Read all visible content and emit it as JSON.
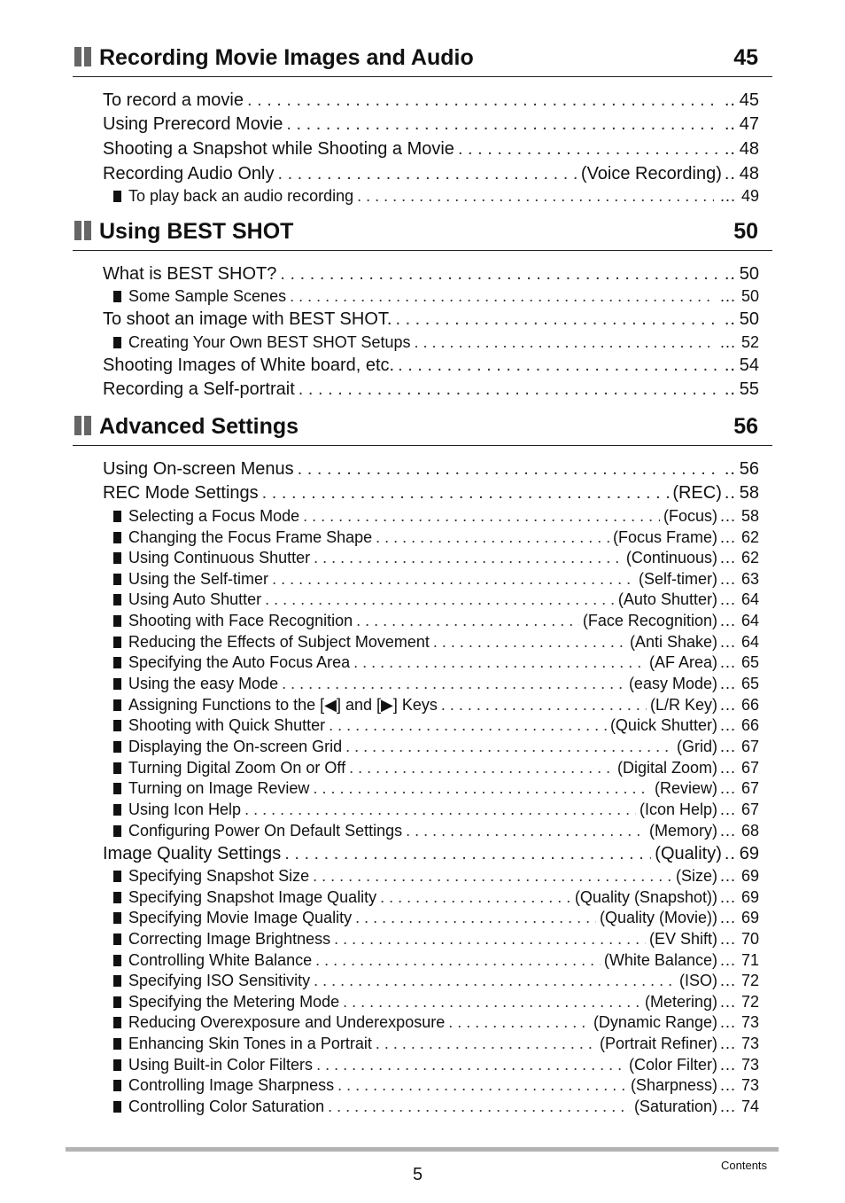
{
  "sections": [
    {
      "title": "Recording Movie Images and Audio",
      "page": "45",
      "entries": [
        {
          "level": 1,
          "label": "To record a movie",
          "ref": "",
          "page": "45"
        },
        {
          "level": 1,
          "label": "Using Prerecord Movie",
          "ref": "",
          "page": "47"
        },
        {
          "level": 1,
          "label": "Shooting a Snapshot while Shooting a Movie",
          "ref": "",
          "page": "48"
        },
        {
          "level": 1,
          "label": "Recording Audio Only",
          "ref": "(Voice Recording)",
          "page": "48"
        },
        {
          "level": 2,
          "label": "To play back an audio recording",
          "ref": "",
          "page": "49"
        }
      ]
    },
    {
      "title": "Using BEST SHOT",
      "page": "50",
      "entries": [
        {
          "level": 1,
          "label": "What is BEST SHOT?",
          "ref": "",
          "page": "50"
        },
        {
          "level": 2,
          "label": "Some Sample Scenes",
          "ref": "",
          "page": "50"
        },
        {
          "level": 1,
          "label": "To shoot an image with BEST SHOT.",
          "ref": "",
          "page": "50"
        },
        {
          "level": 2,
          "label": "Creating Your Own BEST SHOT Setups",
          "ref": "",
          "page": "52"
        },
        {
          "level": 1,
          "label": "Shooting Images of White board, etc.",
          "ref": "",
          "page": "54"
        },
        {
          "level": 1,
          "label": "Recording a Self-portrait",
          "ref": "",
          "page": "55"
        }
      ]
    },
    {
      "title": "Advanced Settings",
      "page": "56",
      "entries": [
        {
          "level": 1,
          "label": "Using On-screen Menus",
          "ref": "",
          "page": "56"
        },
        {
          "level": 1,
          "label": "REC Mode Settings",
          "ref": "(REC)",
          "page": "58"
        },
        {
          "level": 2,
          "label": "Selecting a Focus Mode",
          "ref": "(Focus)",
          "page": "58"
        },
        {
          "level": 2,
          "label": "Changing the Focus Frame Shape",
          "ref": "(Focus Frame)",
          "page": "62"
        },
        {
          "level": 2,
          "label": "Using Continuous Shutter",
          "ref": "(Continuous)",
          "page": "62"
        },
        {
          "level": 2,
          "label": "Using the Self-timer",
          "ref": "(Self-timer)",
          "page": "63"
        },
        {
          "level": 2,
          "label": "Using Auto Shutter",
          "ref": "(Auto Shutter)",
          "page": "64"
        },
        {
          "level": 2,
          "label": "Shooting with Face Recognition",
          "ref": "(Face Recognition)",
          "page": "64"
        },
        {
          "level": 2,
          "label": "Reducing the Effects of Subject Movement",
          "ref": "(Anti Shake)",
          "page": "64"
        },
        {
          "level": 2,
          "label": "Specifying the Auto Focus Area",
          "ref": "(AF Area)",
          "page": "65"
        },
        {
          "level": 2,
          "label": "Using the easy Mode",
          "ref": "(easy Mode)",
          "page": "65"
        },
        {
          "level": 2,
          "label": "Assigning Functions to the [◀] and [▶] Keys",
          "ref": "(L/R Key)",
          "page": "66"
        },
        {
          "level": 2,
          "label": "Shooting with Quick Shutter",
          "ref": "(Quick Shutter)",
          "page": "66"
        },
        {
          "level": 2,
          "label": "Displaying the On-screen Grid",
          "ref": "(Grid)",
          "page": "67"
        },
        {
          "level": 2,
          "label": "Turning Digital Zoom On or Off",
          "ref": "(Digital Zoom)",
          "page": "67"
        },
        {
          "level": 2,
          "label": "Turning on Image Review",
          "ref": "(Review)",
          "page": "67"
        },
        {
          "level": 2,
          "label": "Using Icon Help",
          "ref": "(Icon Help)",
          "page": "67"
        },
        {
          "level": 2,
          "label": "Configuring Power On Default Settings",
          "ref": "(Memory)",
          "page": "68"
        },
        {
          "level": 1,
          "label": "Image Quality Settings",
          "ref": "(Quality)",
          "page": "69"
        },
        {
          "level": 2,
          "label": "Specifying Snapshot Size",
          "ref": "(Size)",
          "page": "69"
        },
        {
          "level": 2,
          "label": "Specifying Snapshot Image Quality",
          "ref": "(Quality (Snapshot))",
          "page": "69"
        },
        {
          "level": 2,
          "label": "Specifying Movie Image Quality",
          "ref": "(Quality (Movie))",
          "page": "69"
        },
        {
          "level": 2,
          "label": "Correcting Image Brightness",
          "ref": "(EV Shift)",
          "page": "70"
        },
        {
          "level": 2,
          "label": "Controlling White Balance",
          "ref": "(White Balance)",
          "page": "71"
        },
        {
          "level": 2,
          "label": "Specifying ISO Sensitivity",
          "ref": "(ISO)",
          "page": "72"
        },
        {
          "level": 2,
          "label": "Specifying the Metering Mode",
          "ref": "(Metering)",
          "page": "72"
        },
        {
          "level": 2,
          "label": "Reducing Overexposure and Underexposure",
          "ref": "(Dynamic Range)",
          "page": "73"
        },
        {
          "level": 2,
          "label": "Enhancing Skin Tones in a Portrait",
          "ref": "(Portrait Refiner)",
          "page": "73"
        },
        {
          "level": 2,
          "label": "Using Built-in Color Filters",
          "ref": "(Color Filter)",
          "page": "73"
        },
        {
          "level": 2,
          "label": "Controlling Image Sharpness",
          "ref": "(Sharpness)",
          "page": "73"
        },
        {
          "level": 2,
          "label": "Controlling Color Saturation",
          "ref": "(Saturation)",
          "page": "74"
        }
      ]
    }
  ],
  "footer": {
    "page_number": "5",
    "label": "Contents"
  }
}
